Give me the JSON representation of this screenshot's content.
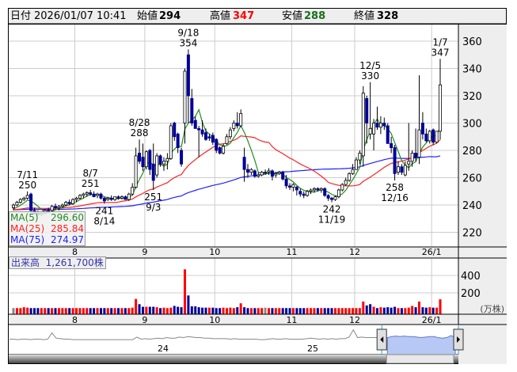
{
  "header": {
    "date_label": "日付",
    "datetime": "2026/01/07 10:41",
    "open_label": "始値",
    "open": "294",
    "high_label": "高値",
    "high": "347",
    "low_label": "安値",
    "low": "288",
    "close_label": "終値",
    "close": "328"
  },
  "legend": {
    "ma5_label": "MA(5)",
    "ma5": "296.60",
    "ma25_label": "MA(25)",
    "ma25": "285.84",
    "ma75_label": "MA(75)",
    "ma75": "274.97"
  },
  "volume_panel": {
    "label": "出来高",
    "value": "1,261,700株",
    "unit": "(万株)"
  },
  "colors": {
    "up_fill": "#ffffff",
    "down_fill": "#000099",
    "ma5": "#228b22",
    "ma25": "#ff2020",
    "ma75": "#2020ff",
    "vol_up": "#ff0000",
    "vol_down": "#000099",
    "vol_flat": "#888888",
    "grid": "#cccccc",
    "panel": "#eeeeee"
  },
  "chart_data": {
    "type": "candlestick",
    "title": "",
    "price_axis": {
      "ticks": [
        220,
        240,
        260,
        280,
        300,
        320,
        340,
        360
      ],
      "range": [
        215,
        365
      ]
    },
    "volume_axis": {
      "ticks": [
        200,
        400
      ],
      "unit": "万株"
    },
    "month_labels": [
      {
        "label": "8",
        "index": 18
      },
      {
        "label": "9",
        "index": 38
      },
      {
        "label": "10",
        "index": 58
      },
      {
        "label": "11",
        "index": 80
      },
      {
        "label": "12",
        "index": 98
      },
      {
        "label": "26/1",
        "index": 120
      }
    ],
    "navigator_labels": [
      "24",
      "25"
    ],
    "ohlc": [
      [
        238,
        241,
        236,
        240
      ],
      [
        240,
        243,
        239,
        242
      ],
      [
        242,
        245,
        241,
        244
      ],
      [
        244,
        246,
        243,
        245
      ],
      [
        245,
        250,
        244,
        247
      ],
      [
        248,
        249,
        234,
        236
      ],
      [
        236,
        238,
        233,
        234
      ],
      [
        234,
        236,
        232,
        233
      ],
      [
        233,
        235,
        232,
        234
      ],
      [
        234,
        237,
        233,
        236
      ],
      [
        236,
        238,
        234,
        235
      ],
      [
        236,
        240,
        235,
        239
      ],
      [
        239,
        241,
        237,
        238
      ],
      [
        238,
        240,
        236,
        239
      ],
      [
        239,
        241,
        238,
        240
      ],
      [
        240,
        243,
        239,
        242
      ],
      [
        242,
        244,
        240,
        241
      ],
      [
        241,
        245,
        240,
        244
      ],
      [
        244,
        246,
        242,
        245
      ],
      [
        245,
        248,
        244,
        247
      ],
      [
        247,
        249,
        245,
        248
      ],
      [
        248,
        250,
        246,
        249
      ],
      [
        249,
        251,
        247,
        248
      ],
      [
        248,
        250,
        246,
        246
      ],
      [
        247,
        249,
        245,
        248
      ],
      [
        248,
        249,
        244,
        245
      ],
      [
        245,
        246,
        241,
        243
      ],
      [
        244,
        246,
        243,
        245
      ],
      [
        245,
        247,
        243,
        244
      ],
      [
        244,
        246,
        243,
        246
      ],
      [
        246,
        247,
        244,
        245
      ],
      [
        245,
        247,
        244,
        246
      ],
      [
        246,
        247,
        244,
        244
      ],
      [
        244,
        249,
        243,
        248
      ],
      [
        248,
        256,
        247,
        253
      ],
      [
        253,
        282,
        252,
        276
      ],
      [
        278,
        288,
        270,
        272
      ],
      [
        275,
        285,
        265,
        268
      ],
      [
        268,
        280,
        266,
        279
      ],
      [
        280,
        281,
        262,
        266
      ],
      [
        270,
        285,
        251,
        258
      ],
      [
        262,
        278,
        260,
        276
      ],
      [
        276,
        277,
        268,
        270
      ],
      [
        270,
        275,
        265,
        272
      ],
      [
        272,
        278,
        266,
        274
      ],
      [
        274,
        300,
        273,
        298
      ],
      [
        300,
        301,
        287,
        290
      ],
      [
        292,
        293,
        278,
        282
      ],
      [
        280,
        282,
        268,
        270
      ],
      [
        300,
        340,
        285,
        338
      ],
      [
        350,
        354,
        300,
        320
      ],
      [
        318,
        325,
        298,
        300
      ],
      [
        302,
        305,
        296,
        296
      ],
      [
        296,
        298,
        275,
        295
      ],
      [
        295,
        302,
        290,
        292
      ],
      [
        293,
        296,
        287,
        288
      ],
      [
        290,
        292,
        287,
        289
      ],
      [
        291,
        293,
        284,
        286
      ],
      [
        288,
        289,
        278,
        280
      ],
      [
        282,
        283,
        277,
        278
      ],
      [
        278,
        285,
        277,
        283
      ],
      [
        285,
        292,
        284,
        290
      ],
      [
        290,
        297,
        288,
        295
      ],
      [
        296,
        302,
        294,
        300
      ],
      [
        300,
        308,
        296,
        298
      ],
      [
        298,
        310,
        297,
        307
      ],
      [
        275,
        282,
        257,
        266
      ],
      [
        266,
        270,
        260,
        264
      ],
      [
        264,
        267,
        262,
        266
      ],
      [
        265,
        266,
        260,
        261
      ],
      [
        261,
        264,
        260,
        262
      ],
      [
        262,
        265,
        261,
        264
      ],
      [
        264,
        266,
        262,
        264
      ],
      [
        264,
        267,
        262,
        265
      ],
      [
        265,
        266,
        258,
        261
      ],
      [
        262,
        264,
        260,
        263
      ],
      [
        263,
        265,
        262,
        264
      ],
      [
        264,
        265,
        258,
        259
      ],
      [
        259,
        262,
        252,
        254
      ],
      [
        254,
        256,
        251,
        253
      ],
      [
        253,
        256,
        250,
        255
      ],
      [
        253,
        254,
        247,
        251
      ],
      [
        250,
        252,
        246,
        248
      ],
      [
        248,
        250,
        245,
        247
      ],
      [
        247,
        251,
        246,
        250
      ],
      [
        250,
        252,
        248,
        251
      ],
      [
        251,
        253,
        249,
        252
      ],
      [
        252,
        253,
        250,
        251
      ],
      [
        251,
        253,
        249,
        252
      ],
      [
        252,
        253,
        246,
        247
      ],
      [
        247,
        248,
        243,
        245
      ],
      [
        245,
        246,
        242,
        244
      ],
      [
        244,
        247,
        243,
        246
      ],
      [
        246,
        252,
        245,
        251
      ],
      [
        251,
        256,
        250,
        255
      ],
      [
        255,
        260,
        254,
        258
      ],
      [
        258,
        264,
        257,
        263
      ],
      [
        263,
        270,
        262,
        266
      ],
      [
        266,
        275,
        266,
        273
      ],
      [
        273,
        280,
        270,
        278
      ],
      [
        276,
        327,
        268,
        322
      ],
      [
        318,
        320,
        285,
        300
      ],
      [
        292,
        330,
        288,
        296
      ],
      [
        292,
        303,
        280,
        300
      ],
      [
        300,
        312,
        295,
        297
      ],
      [
        297,
        305,
        292,
        300
      ],
      [
        300,
        304,
        295,
        298
      ],
      [
        298,
        300,
        290,
        285
      ],
      [
        285,
        290,
        278,
        282
      ],
      [
        282,
        284,
        258,
        263
      ],
      [
        264,
        272,
        262,
        268
      ],
      [
        268,
        270,
        262,
        264
      ],
      [
        262,
        272,
        261,
        269
      ],
      [
        270,
        300,
        265,
        272
      ],
      [
        272,
        280,
        268,
        278
      ],
      [
        278,
        296,
        272,
        275
      ],
      [
        275,
        335,
        270,
        295
      ],
      [
        300,
        308,
        288,
        292
      ],
      [
        292,
        296,
        286,
        287
      ],
      [
        287,
        295,
        285,
        294
      ],
      [
        295,
        296,
        284,
        286
      ],
      [
        286,
        294,
        285,
        294
      ],
      [
        294,
        347,
        288,
        328
      ]
    ],
    "volume": [
      25,
      25,
      25,
      35,
      30,
      25,
      25,
      25,
      25,
      25,
      25,
      25,
      25,
      25,
      25,
      25,
      25,
      25,
      25,
      25,
      25,
      25,
      25,
      25,
      25,
      25,
      25,
      25,
      25,
      25,
      25,
      25,
      25,
      25,
      30,
      130,
      70,
      40,
      40,
      40,
      40,
      35,
      25,
      30,
      25,
      30,
      50,
      40,
      35,
      470,
      170,
      45,
      45,
      35,
      30,
      30,
      30,
      30,
      25,
      25,
      30,
      25,
      30,
      25,
      35,
      80,
      35,
      25,
      25,
      25,
      25,
      25,
      30,
      25,
      25,
      25,
      25,
      25,
      25,
      25,
      25,
      25,
      25,
      25,
      25,
      25,
      25,
      25,
      25,
      25,
      25,
      25,
      25,
      25,
      25,
      25,
      25,
      25,
      25,
      25,
      100,
      55,
      70,
      40,
      25,
      35,
      30,
      35,
      30,
      40,
      25,
      25,
      25,
      30,
      50,
      35,
      100,
      35,
      30,
      35,
      30,
      30,
      126
    ],
    "annotations": [
      {
        "index": 4,
        "date": "7/11",
        "value": "250",
        "pos": "above"
      },
      {
        "index": 22,
        "date": "8/7",
        "value": "251",
        "pos": "above"
      },
      {
        "index": 26,
        "date": "8/14",
        "value": "241",
        "pos": "below"
      },
      {
        "index": 36,
        "date": "8/28",
        "value": "288",
        "pos": "above"
      },
      {
        "index": 40,
        "date": "9/3",
        "value": "251",
        "pos": "below"
      },
      {
        "index": 50,
        "date": "9/18",
        "value": "354",
        "pos": "above"
      },
      {
        "index": 91,
        "date": "11/19",
        "value": "242",
        "pos": "below"
      },
      {
        "index": 102,
        "date": "12/5",
        "value": "330",
        "pos": "above"
      },
      {
        "index": 109,
        "date": "12/16",
        "value": "258",
        "pos": "below"
      },
      {
        "index": 122,
        "date": "1/7",
        "value": "347",
        "pos": "above"
      }
    ],
    "navigator_history": [
      30,
      30,
      29,
      30,
      30,
      29,
      30,
      30,
      29,
      30,
      42,
      32,
      31,
      30,
      30,
      29,
      29,
      29,
      29,
      29,
      29,
      29,
      29,
      29,
      29,
      29,
      29,
      29,
      29,
      29,
      34,
      30,
      31,
      30,
      31,
      32,
      31,
      33,
      32,
      32,
      34,
      33,
      35,
      34,
      33,
      33,
      32,
      32,
      31,
      31,
      31,
      31,
      30,
      31,
      30,
      30,
      30,
      30,
      30,
      29,
      29,
      30,
      31,
      30,
      30,
      31,
      30,
      30,
      30,
      30,
      31,
      32,
      31,
      30,
      31,
      30,
      31,
      30,
      31,
      31,
      34,
      48,
      33,
      34,
      33,
      33,
      33,
      33,
      33,
      33,
      35,
      36,
      35,
      36,
      35,
      35,
      34,
      33,
      34,
      35,
      35,
      33,
      32,
      33,
      37,
      33
    ]
  }
}
